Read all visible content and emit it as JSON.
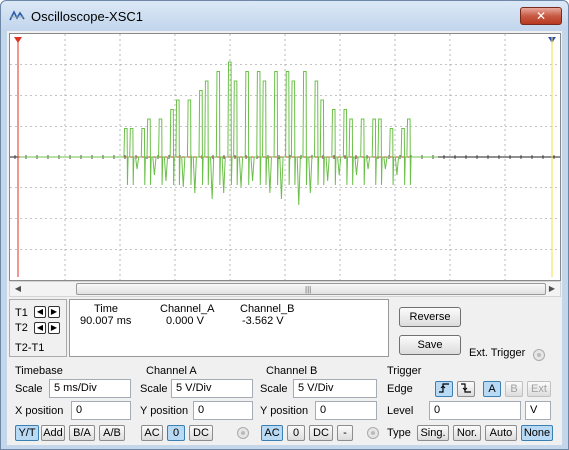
{
  "window": {
    "title": "Oscilloscope-XSC1",
    "close_label": "✕"
  },
  "colors": {
    "channel_a": "#6cc04a",
    "channel_b": "#c8462a",
    "grid": "#8a8a8a",
    "t1_marker": "#e03020",
    "t2_marker": "#f0e040"
  },
  "scope": {
    "waveform_a": [
      0,
      0,
      0,
      0,
      0,
      0,
      0,
      0,
      0,
      0,
      0,
      0,
      0,
      0,
      0,
      0,
      0,
      0,
      0.3,
      0.3,
      -0.2,
      0.3,
      0.4,
      -0.3,
      0.4,
      -0.4,
      0.5,
      0.6,
      -0.5,
      0.6,
      -0.6,
      0.7,
      0.8,
      -0.7,
      0.9,
      -0.6,
      1.0,
      0.8,
      -0.5,
      0.9,
      -0.4,
      0.9,
      0.8,
      -0.6,
      0.9,
      -0.7,
      0.9,
      0.8,
      -0.8,
      0.9,
      -0.6,
      0.8,
      0.6,
      -0.4,
      0.5,
      -0.3,
      0.5,
      0.4,
      -0.3,
      0.4,
      -0.2,
      0.4,
      0.4,
      -0.2,
      0.3,
      -0.3,
      0.3,
      0.4,
      0,
      0,
      0
    ]
  },
  "cursors": {
    "t1_label": "T1",
    "t2_label": "T2",
    "t2_t1_label": "T2-T1",
    "left_arrow": "◀",
    "right_arrow": "▶"
  },
  "readout": {
    "headers": {
      "time": "Time",
      "channel_a": "Channel_A",
      "channel_b": "Channel_B"
    },
    "row1": {
      "time": "90.007 ms",
      "channel_a": "0.000 V",
      "channel_b": "-3.562 V"
    }
  },
  "actions": {
    "reverse": "Reverse",
    "save": "Save",
    "ext_trigger": "Ext. Trigger"
  },
  "timebase": {
    "title": "Timebase",
    "scale_label": "Scale",
    "scale_value": "5 ms/Div",
    "xpos_label": "X position",
    "xpos_value": "0",
    "modes": [
      "Y/T",
      "Add",
      "B/A",
      "A/B"
    ]
  },
  "channel_a": {
    "title": "Channel A",
    "scale_label": "Scale",
    "scale_value": "5  V/Div",
    "ypos_label": "Y position",
    "ypos_value": "0",
    "coupling": [
      "AC",
      "0",
      "DC"
    ]
  },
  "channel_b": {
    "title": "Channel B",
    "scale_label": "Scale",
    "scale_value": "5  V/Div",
    "ypos_label": "Y position",
    "ypos_value": "0",
    "coupling": [
      "AC",
      "0",
      "DC",
      "-"
    ]
  },
  "trigger": {
    "title": "Trigger",
    "edge_label": "Edge",
    "edge_sources": [
      "A",
      "B",
      "Ext"
    ],
    "level_label": "Level",
    "level_value": "0",
    "level_unit": "V",
    "type_label": "Type",
    "types": [
      "Sing.",
      "Nor.",
      "Auto",
      "None"
    ]
  }
}
